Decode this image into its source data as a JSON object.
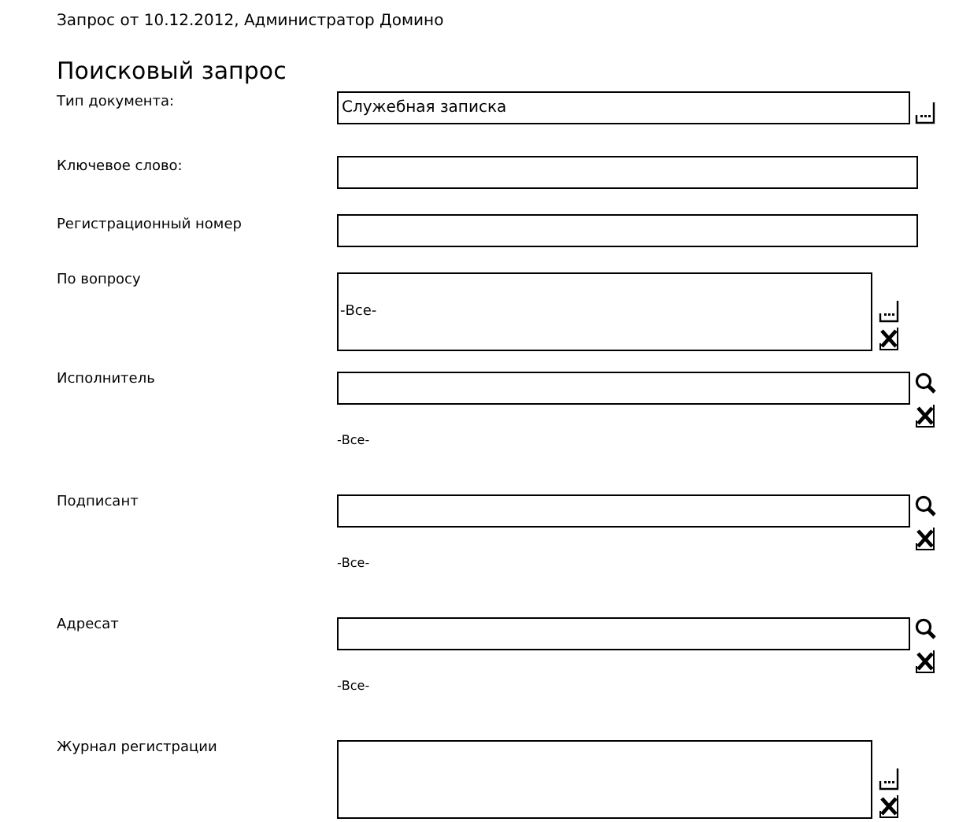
{
  "header": "Запрос от 10.12.2012, Администратор Домино",
  "title": "Поисковый запрос",
  "fields": [
    {
      "kind": "lookup",
      "label": "Тип документа:",
      "value": "Служебная записка"
    },
    {
      "kind": "text",
      "label": "Ключевое слово:"
    },
    {
      "kind": "text",
      "label": "Регистрационный номер"
    },
    {
      "kind": "list",
      "label": "По вопросу",
      "value": "-Все-"
    },
    {
      "kind": "person",
      "label": "Исполнитель",
      "note": "-Все-"
    },
    {
      "kind": "person",
      "label": "Подписант",
      "note": "-Все-"
    },
    {
      "kind": "person",
      "label": "Адресат",
      "note": "-Все-"
    },
    {
      "kind": "list",
      "label": "Журнал регистрации"
    }
  ]
}
